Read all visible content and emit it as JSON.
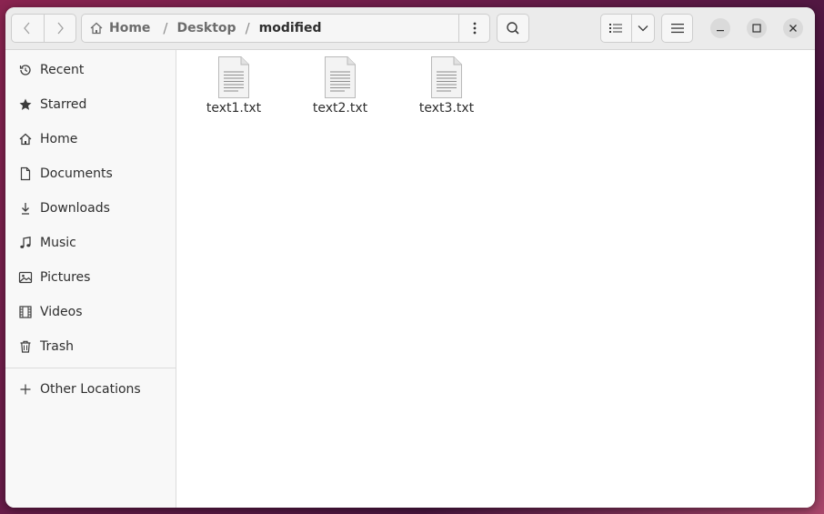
{
  "path": {
    "home": "Home",
    "desktop": "Desktop",
    "current": "modified",
    "separator": "/"
  },
  "sidebar": {
    "items": [
      {
        "label": "Recent",
        "icon": "clock-icon"
      },
      {
        "label": "Starred",
        "icon": "star-icon"
      },
      {
        "label": "Home",
        "icon": "home-icon"
      },
      {
        "label": "Documents",
        "icon": "document-icon"
      },
      {
        "label": "Downloads",
        "icon": "download-icon"
      },
      {
        "label": "Music",
        "icon": "music-note-icon"
      },
      {
        "label": "Pictures",
        "icon": "picture-icon"
      },
      {
        "label": "Videos",
        "icon": "film-icon"
      },
      {
        "label": "Trash",
        "icon": "trash-icon"
      }
    ],
    "other_locations": {
      "label": "Other Locations",
      "icon": "plus-icon"
    }
  },
  "files": [
    {
      "name": "text1.txt",
      "icon": "text-file-icon"
    },
    {
      "name": "text2.txt",
      "icon": "text-file-icon"
    },
    {
      "name": "text3.txt",
      "icon": "text-file-icon"
    }
  ],
  "colors": {
    "background": "#7a2050",
    "headerbar": "#ebebeb",
    "sidebar": "#f8f8f8"
  }
}
